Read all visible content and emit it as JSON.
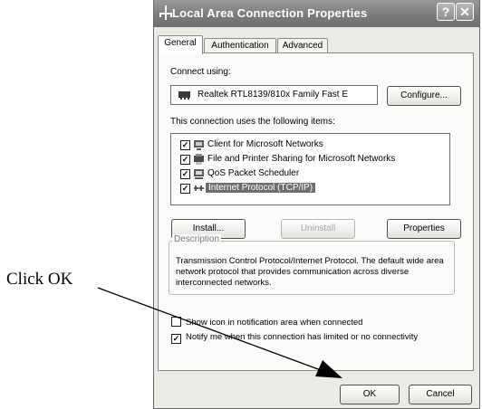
{
  "window": {
    "title": "Local Area Connection Properties",
    "help_glyph": "?",
    "close_glyph": "✕",
    "title_icon": "network-connection-icon"
  },
  "tabs": [
    {
      "label": "General",
      "active": true
    },
    {
      "label": "Authentication",
      "active": false
    },
    {
      "label": "Advanced",
      "active": false
    }
  ],
  "general": {
    "connect_using_label": "Connect using:",
    "device_name": "Realtek RTL8139/810x Family Fast E",
    "device_icon": "network-adapter-icon",
    "configure_label": "Configure...",
    "items_label": "This connection uses the following items:",
    "items": [
      {
        "label": "Client for Microsoft Networks",
        "checked": true,
        "icon": "client-network-icon",
        "selected": false
      },
      {
        "label": "File and Printer Sharing for Microsoft Networks",
        "checked": true,
        "icon": "file-printer-sharing-icon",
        "selected": false
      },
      {
        "label": "QoS Packet Scheduler",
        "checked": true,
        "icon": "qos-scheduler-icon",
        "selected": false
      },
      {
        "label": "Internet Protocol (TCP/IP)",
        "checked": true,
        "icon": "protocol-icon",
        "selected": true
      }
    ],
    "install_label": "Install...",
    "uninstall_label": "Uninstall",
    "properties_label": "Properties",
    "description_title": "Description",
    "description_text": "Transmission Control Protocol/Internet Protocol. The default wide area network protocol that provides communication across diverse interconnected networks.",
    "show_icon_label": "Show icon in notification area when connected",
    "show_icon_checked": false,
    "notify_label": "Notify me when this connection has limited or no connectivity",
    "notify_checked": true,
    "check_glyph": "✓"
  },
  "footer": {
    "ok_label": "OK",
    "cancel_label": "Cancel"
  },
  "annotation": {
    "callout_text": "Click OK"
  }
}
